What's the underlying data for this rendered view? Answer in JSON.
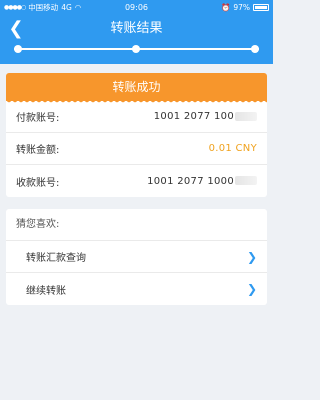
{
  "status_bar": {
    "carrier": "中国移动",
    "network": "4G",
    "time": "09:06",
    "battery": "97%"
  },
  "nav": {
    "title": "转账结果",
    "progress_steps": 3,
    "progress_current": 3
  },
  "result": {
    "header": "转账成功",
    "rows": [
      {
        "label": "付款账号:",
        "value": "1001 2077 100"
      },
      {
        "label": "转账金额:",
        "value": "0.01 CNY"
      },
      {
        "label": "收款账号:",
        "value": "1001 2077 1000"
      }
    ]
  },
  "recommend": {
    "title": "猜您喜欢:",
    "items": [
      {
        "label": "转账汇款查询"
      },
      {
        "label": "继续转账"
      }
    ]
  },
  "colors": {
    "primary": "#2f9af0",
    "accent": "#f7962c",
    "amount": "#f0a21e"
  },
  "icons": {
    "back": "chevron-left-icon",
    "item": "chevron-right-icon"
  }
}
